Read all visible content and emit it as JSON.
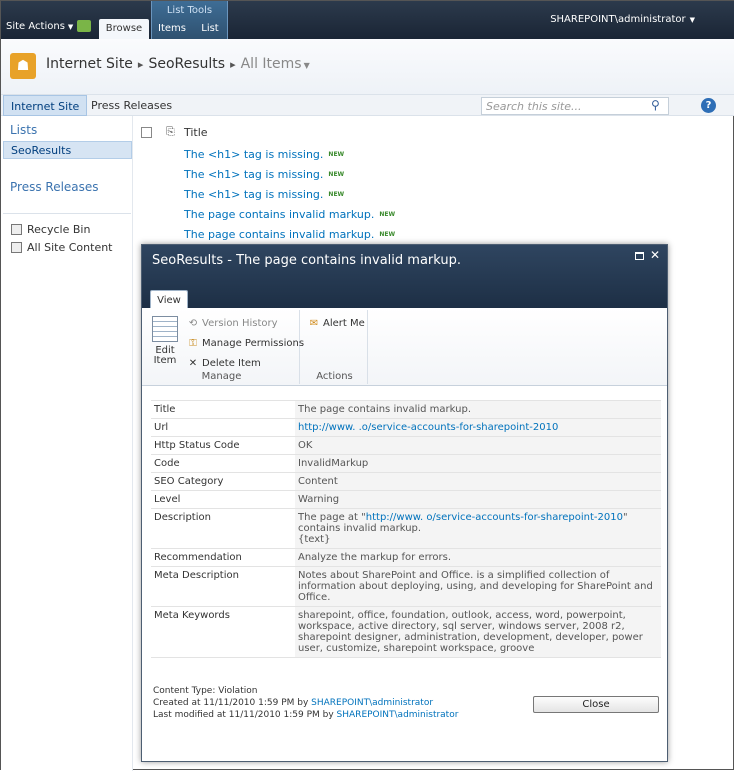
{
  "ribbon": {
    "site_actions": "Site Actions",
    "list_tools": "List Tools",
    "tabs": [
      "Browse",
      "Items",
      "List"
    ],
    "user": "SHAREPOINT\\administrator"
  },
  "breadcrumb": {
    "site": "Internet Site",
    "list": "SeoResults",
    "view": "All Items"
  },
  "topnav": {
    "items": [
      "Internet Site",
      "Press Releases"
    ],
    "search_placeholder": "Search this site..."
  },
  "leftnav": {
    "lists_heading": "Lists",
    "selected": "SeoResults",
    "press_heading": "Press Releases",
    "recycle_bin": "Recycle Bin",
    "all_content": "All Site Content"
  },
  "list": {
    "column_title": "Title",
    "new_badge": "NEW",
    "rows": [
      "The <h1> tag is missing.",
      "The <h1> tag is missing.",
      "The <h1> tag is missing.",
      "The page contains invalid markup.",
      "The page contains invalid markup."
    ]
  },
  "dialog": {
    "title": "SeoResults - The page contains invalid markup.",
    "tab": "View",
    "ribbon": {
      "edit_item": "Edit Item",
      "version_history": "Version History",
      "manage_permissions": "Manage Permissions",
      "delete_item": "Delete Item",
      "manage_group": "Manage",
      "alert_me": "Alert Me",
      "actions_group": "Actions"
    },
    "fields": [
      {
        "label": "Title",
        "value": "The page contains invalid markup."
      },
      {
        "label": "Url",
        "value": "http://www.            .o/service-accounts-for-sharepoint-2010"
      },
      {
        "label": "Http Status Code",
        "value": "OK"
      },
      {
        "label": "Code",
        "value": "InvalidMarkup"
      },
      {
        "label": "SEO Category",
        "value": "Content"
      },
      {
        "label": "Level",
        "value": "Warning"
      },
      {
        "label": "Description",
        "value_pre": "The page at \"",
        "value_link": "http://www.            o/service-accounts-for-sharepoint-2010",
        "value_post": "\" contains invalid markup.",
        "value_extra": "{text}"
      },
      {
        "label": "Recommendation",
        "value": "Analyze the markup for errors."
      },
      {
        "label": "Meta Description",
        "value": "Notes about SharePoint and Office.            is a simplified collection of information about deploying, using, and developing for SharePoint and Office."
      },
      {
        "label": "Meta Keywords",
        "value": "sharepoint, office, foundation, outlook, access, word, powerpoint, workspace, active directory, sql server, windows server, 2008 r2, sharepoint designer, administration, development, developer, power user, customize, sharepoint workspace, groove"
      }
    ],
    "footer": {
      "content_type": "Content Type: Violation",
      "created_pre": "Created at 11/11/2010 1:59 PM by ",
      "created_by": "SHAREPOINT\\administrator",
      "modified_pre": "Last modified at 11/11/2010 1:59 PM by ",
      "modified_by": "SHAREPOINT\\administrator",
      "close": "Close"
    }
  }
}
